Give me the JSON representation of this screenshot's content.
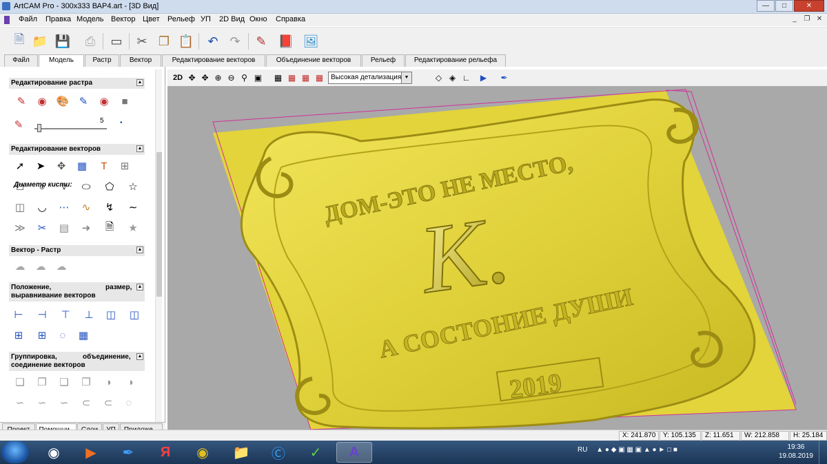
{
  "window": {
    "title": "ArtCAM Pro - 300x333 ВАР4.art - [3D Вид]"
  },
  "menu": [
    "Файл",
    "Правка",
    "Модель",
    "Вектор",
    "Цвет",
    "Рельеф",
    "УП",
    "2D Вид",
    "Окно",
    "Справка"
  ],
  "toolbar": {
    "icons": [
      "new-file-icon",
      "open-folder-icon",
      "save-icon",
      "print-icon",
      "frame-icon",
      "cut-icon",
      "copy-icon",
      "paste-icon",
      "undo-icon",
      "redo-icon",
      "edit-icon",
      "book-icon",
      "wizard-icon"
    ]
  },
  "main_tabs": [
    "Файл",
    "Модель",
    "Растр",
    "Вектор",
    "Редактирование векторов",
    "Объединение векторов",
    "Рельеф",
    "Редактирование рельефа"
  ],
  "left_panel": {
    "sections": {
      "raster_edit": "Редактирование растра",
      "brush_label": "Диаметр кисти:",
      "brush_value": "5",
      "vector_edit": "Редактирование векторов",
      "vector_raster": "Вектор - Растр",
      "position_a": "Положение,",
      "position_b": "размер,",
      "position_c": "выравнивание векторов",
      "group_a": "Группировка,",
      "group_b": "объединение,",
      "group_c": "соединение векторов"
    },
    "bottom_tabs": [
      "Проект",
      "Помощни..",
      "Слои",
      "УП",
      "Приложе..."
    ]
  },
  "viewbar": {
    "mode_label": "2D",
    "detail": "Высокая детализация"
  },
  "relief": {
    "top_text": "ДОМ-ЭТО НЕ МЕСТО,",
    "monogram": "К.",
    "bottom_text": "А СОСТОНИЕ ДУШИ",
    "year": "2019"
  },
  "status": {
    "x": "X: 241.870",
    "y": "Y: 105.135",
    "z": "Z: 11.651",
    "w": "W: 212.858",
    "h": "H: 25.184"
  },
  "taskbar": {
    "lang": "RU",
    "time": "19:36",
    "date": "19.08.2019"
  },
  "colors": {
    "relief": "#d9c92e",
    "relief_dark": "#8e7f10",
    "viewport": "#a9a9a9",
    "bbox": "#d0309a"
  }
}
